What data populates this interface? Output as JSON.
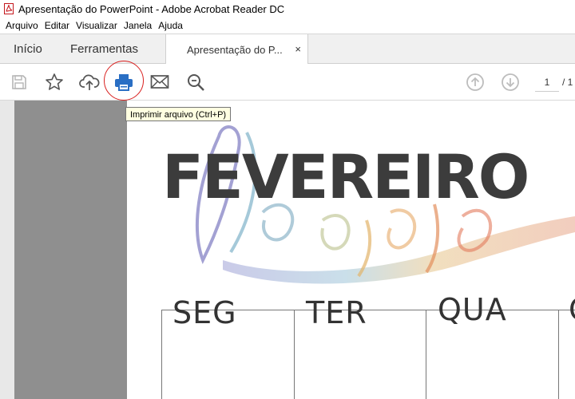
{
  "window": {
    "title": "Apresentação do PowerPoint - Adobe Acrobat Reader DC"
  },
  "menu": [
    "Arquivo",
    "Editar",
    "Visualizar",
    "Janela",
    "Ajuda"
  ],
  "tabs": {
    "home": "Início",
    "tools": "Ferramentas",
    "document": "Apresentação do P...",
    "close": "×"
  },
  "toolbar": {
    "page_current": "1",
    "page_total": "/ 1",
    "tooltip": "Imprimir arquivo (Ctrl+P)"
  },
  "icons": [
    "save-icon",
    "star-icon",
    "cloud-upload-icon",
    "print-icon",
    "mail-icon",
    "zoom-search-icon",
    "arrow-up-icon",
    "arrow-down-icon"
  ],
  "colors": {
    "accent_blue": "#2a6fc4",
    "highlight_red": "#d9201f",
    "tooltip_bg": "#ffffe1"
  },
  "document": {
    "month": "FEVEREIRO",
    "weekdays": [
      "SEG",
      "TER",
      "QUA",
      "Q"
    ]
  }
}
